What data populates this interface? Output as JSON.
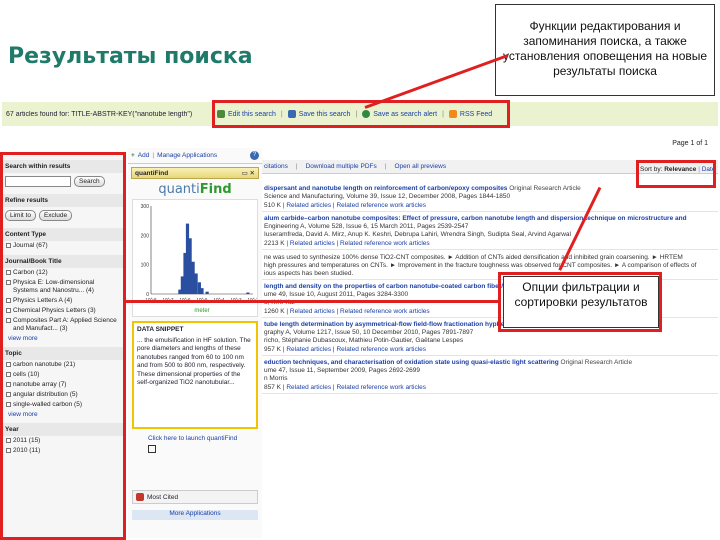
{
  "slide": {
    "title": "Результаты поиска",
    "callout_top": "Функции редактирования и запоминания поиска, а также установления оповещения на новые результаты поиска",
    "callout_mid": "Опции фильтрации и сортировки результатов"
  },
  "toolbar": {
    "results_count": "67 articles found for: TITLE-ABSTR-KEY(\"nanotube length\")",
    "edit_search": "Edit this search",
    "save_search": "Save this search",
    "save_alert": "Save as search alert",
    "rss": "RSS Feed"
  },
  "page_label": "Page 1 of 1",
  "sidebar": {
    "search_within_title": "Search within results",
    "search_button": "Search",
    "refine_title": "Refine results",
    "limit_button": "Limit to",
    "exclude_button": "Exclude",
    "content_type": {
      "title": "Content Type",
      "items": [
        {
          "label": "Journal (67)"
        }
      ]
    },
    "journal_title": {
      "title": "Journal/Book Title",
      "items": [
        {
          "label": "Carbon (12)"
        },
        {
          "label": "Physica E: Low-dimensional Systems and Nanostru... (4)"
        },
        {
          "label": "Physics Letters A (4)"
        },
        {
          "label": "Chemical Physics Letters (3)"
        },
        {
          "label": "Composites Part A: Applied Science and Manufact... (3)"
        }
      ],
      "view_more": "view more"
    },
    "topic": {
      "title": "Topic",
      "items": [
        {
          "label": "carbon nanotube (21)"
        },
        {
          "label": "cells (10)"
        },
        {
          "label": "nanotube array (7)"
        },
        {
          "label": "angular distribution (5)"
        },
        {
          "label": "single-walled carbon (5)"
        }
      ],
      "view_more": "view more"
    },
    "year": {
      "title": "Year",
      "items": [
        {
          "label": "2011 (15)"
        },
        {
          "label": "2010 (11)"
        }
      ]
    }
  },
  "apps": {
    "add_label": "Add",
    "manage_label": "Manage Applications",
    "quantifind_bar": "quantiFind",
    "logo_left": "quanti",
    "logo_right": "Find",
    "axis_label": "meter",
    "data_snippet_title": "DATA SNIPPET",
    "snippet_text": "... the emulsification in HF solution. The pore diameters and lengths of these nanotubes ranged from 60 to 100 nm and from 500 to 800 nm, respectively. These dimensional properties of the self-organized TiO2 nanotubular...",
    "launch_text": "Click here to launch quantiFind",
    "most_cited": "Most Cited",
    "more_apps": "More Applications"
  },
  "chart_data": {
    "type": "bar",
    "x_tick_labels": [
      "10^-8",
      "10^-7",
      "10^-6",
      "10^-5",
      "10^-4",
      "10^-3",
      "10^-2"
    ],
    "y_tick_labels": [
      "0",
      "100",
      "200",
      "300"
    ],
    "ylim": [
      0,
      300
    ],
    "xlabel": "meter",
    "bins": [
      {
        "x": "5e-7",
        "value": 15
      },
      {
        "x": "7e-7",
        "value": 60
      },
      {
        "x": "1e-6",
        "value": 140
      },
      {
        "x": "1.4e-6",
        "value": 240
      },
      {
        "x": "2e-6",
        "value": 190
      },
      {
        "x": "3e-6",
        "value": 110
      },
      {
        "x": "4.5e-6",
        "value": 70
      },
      {
        "x": "7e-6",
        "value": 40
      },
      {
        "x": "1e-5",
        "value": 20
      },
      {
        "x": "2e-5",
        "value": 8
      },
      {
        "x": "5e-3",
        "value": 5
      }
    ]
  },
  "results_toolbar": {
    "citations": "citations",
    "download": "Download multiple PDFs",
    "open_previews": "Open all previews",
    "sort_label": "Sort by:",
    "sort_relevance": "Relevance",
    "sort_date": "Date"
  },
  "results": [
    {
      "title": "dispersant and nanotube length on reinforcement of carbon/epoxy composites",
      "type": "Original Research Article",
      "journal": "Science and Manufacturing, Volume 39, Issue 12, December 2008, Pages 1844-1850",
      "size": "510 K",
      "related": "Related articles",
      "ref_work": "Related reference work articles"
    },
    {
      "title": "alum carbide–carbon nanotube composites: Effect of pressure, carbon nanotube length and dispersion technique on microstructure and",
      "type": "",
      "journal": "Engineering A, Volume 528, Issue 6, 15 March 2011, Pages 2539-2547",
      "authors": "Iuseramfreda, David A. Mirz, Anup K. Keshri, Debrupa Lahiri, Wrendra Singh, Sudipta Seal, Arvind Agarwal",
      "size": "2213 K",
      "related": "Related articles",
      "ref_work": "Related reference work articles"
    },
    {
      "title": "",
      "type": "",
      "journal": "ne was used to synthesize 100% dense TiO2-CNT composites. ► Addition of CNTs aided densification and inhibited grain coarsening. ► HRTEM",
      "journal2": "high pressures and temperatures on CNTs. ► Improvement in the fracture toughness was observed for CNT composites. ► A comparison of effects of",
      "journal3": "ious aspects has been studied.",
      "size": "",
      "related": "",
      "ref_work": ""
    },
    {
      "title": "length and density on the properties of carbon nanotube-coated carbon fiber/polyester composites",
      "type": "Original Research Article",
      "journal": "ume 49, Issue 10, August 2011, Pages 3284-3300",
      "authors": "u, K.K. Kar",
      "size": "1260 K",
      "related": "Related articles",
      "ref_work": "Related reference work articles"
    },
    {
      "title": "tube length determination by asymmetrical-flow field-flow fractionation hyphenated to multi-angle laser-light",
      "type": "",
      "journal": "graphy A, Volume 1217, Issue 50, 10 December 2010, Pages 7891-7897",
      "authors": "richo, Stéphanie Dubascoux, Mathieu Potin-Gautier, Gaëtane Lespes",
      "size": "957 K",
      "related": "Related articles",
      "ref_work": "Related reference work articles"
    },
    {
      "title": "eduction techniques, and characterisation of oxidation state using quasi-elastic light scattering",
      "type": "Original Research Article",
      "journal": "ume 47, Issue 11, September 2009, Pages 2692-2699",
      "authors": "n Morris",
      "size": "857 K",
      "related": "Related articles",
      "ref_work": "Related reference work articles"
    }
  ],
  "colors": {
    "title_teal": "#1f7a6a",
    "annotation_red": "#e02020",
    "link_blue": "#1a3fa8",
    "toolbar_green": "#eaf2cf"
  }
}
